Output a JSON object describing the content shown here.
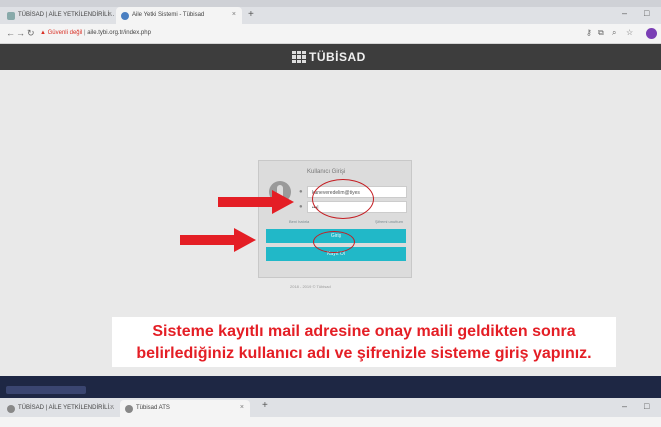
{
  "browser_top": {
    "tabs": [
      {
        "title": "TÜBİSAD | AİLE YETKİLENDİRİLİ..."
      },
      {
        "title": "Aile Yetki Sistemi - Tübisad"
      }
    ],
    "url_warning": "Güvenli değil",
    "url": "aile.tybi.org.tr/index.php"
  },
  "site": {
    "logo_text": "TÜBİSAD"
  },
  "login": {
    "title": "Kullanıcı Girişi",
    "username_value": "kaneveredelim@tiyes",
    "password_value": "•••|",
    "remember_label": "Beni hatırla",
    "forgot_label": "Şifremi unuttum",
    "login_button": "Giriş",
    "register_button": "Kayıt Ol",
    "copyright": "2018 - 2019 © Tübisad"
  },
  "caption": {
    "line1": "Sisteme kayıtlı mail adresine onay maili geldikten sonra",
    "line2": "belirlediğiniz kullanıcı adı ve şifrenizle sisteme giriş yapınız."
  },
  "browser_bottom": {
    "tabs": [
      {
        "title": "TÜBİSAD | AİLE YETKİLENDİRİLİ..."
      },
      {
        "title": "Tübisad ATS"
      }
    ]
  },
  "colors": {
    "header": "#3d3d3d",
    "button": "#21b8c8",
    "annotation_red": "#e41e25"
  }
}
